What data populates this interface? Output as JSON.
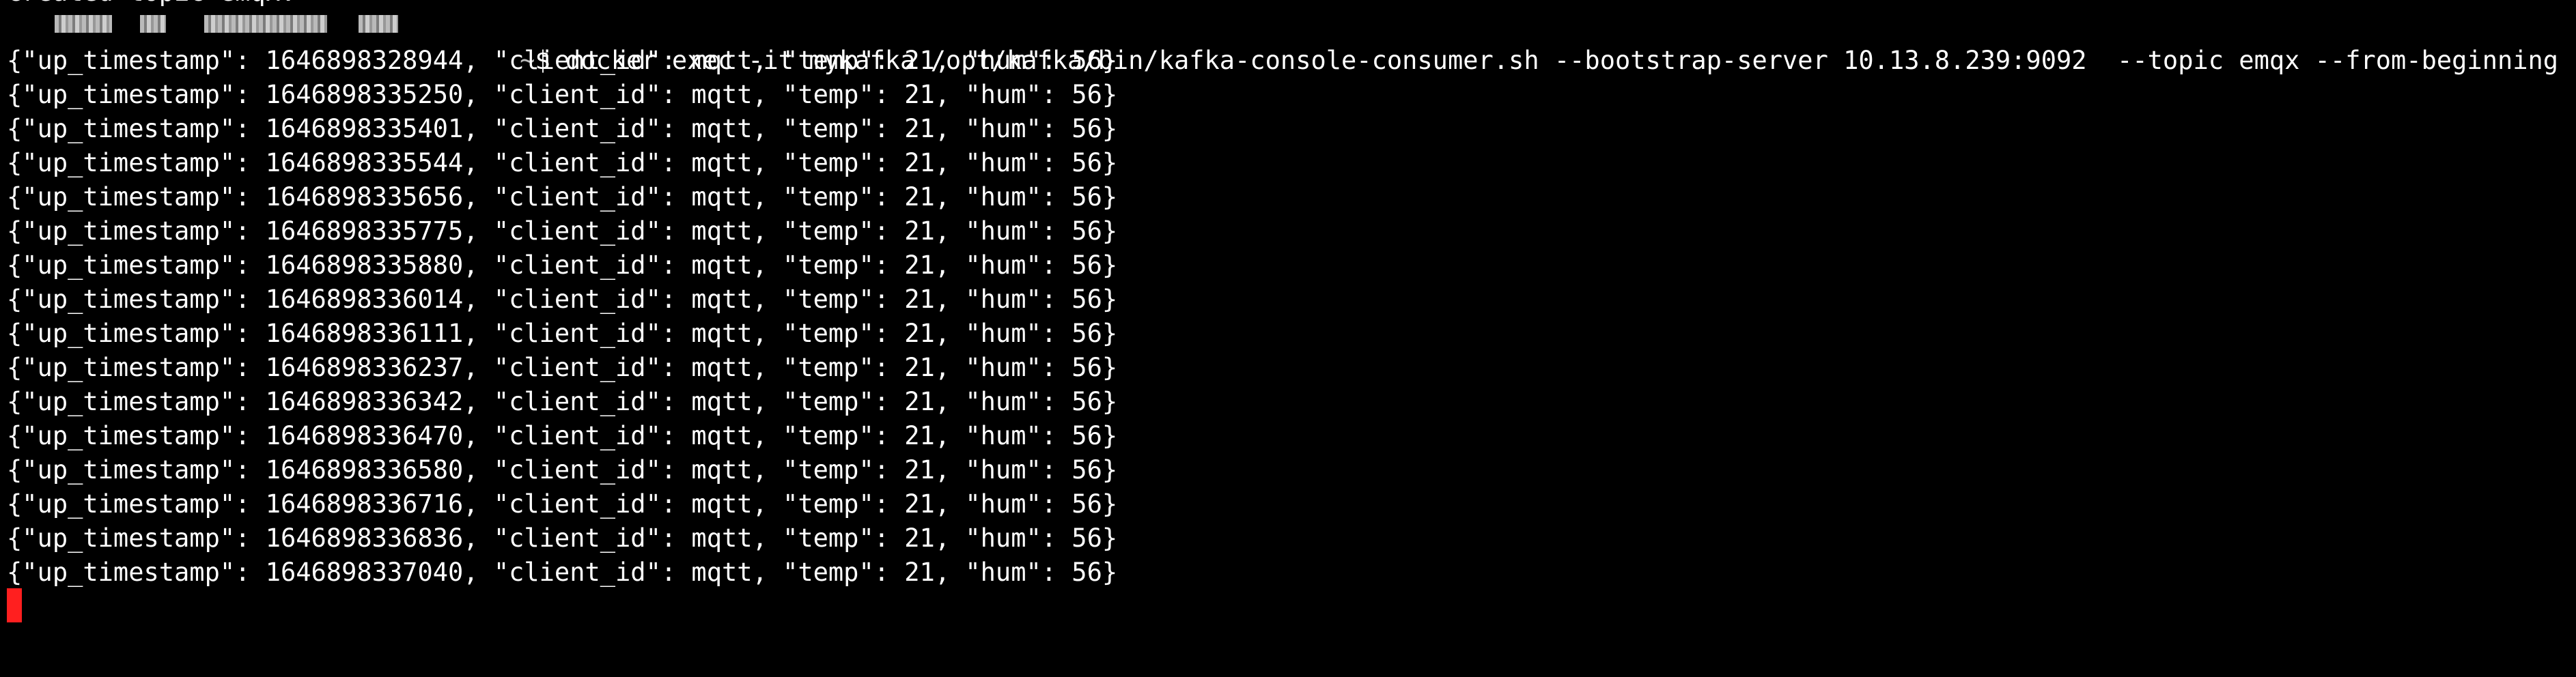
{
  "terminal": {
    "cut_text": "Created topic emqx.",
    "prompt_tilde": "~",
    "prompt_symbol": "$",
    "command": " docker exec -it mykafka /opt/kafka/bin/kafka-console-consumer.sh --bootstrap-server 10.13.8.239:9092  --topic emqx --from-beginning",
    "output_lines": [
      "{\"up_timestamp\": 1646898328944, \"client_id\": mqtt, \"temp\": 21, \"hum\": 56}",
      "{\"up_timestamp\": 1646898335250, \"client_id\": mqtt, \"temp\": 21, \"hum\": 56}",
      "{\"up_timestamp\": 1646898335401, \"client_id\": mqtt, \"temp\": 21, \"hum\": 56}",
      "{\"up_timestamp\": 1646898335544, \"client_id\": mqtt, \"temp\": 21, \"hum\": 56}",
      "{\"up_timestamp\": 1646898335656, \"client_id\": mqtt, \"temp\": 21, \"hum\": 56}",
      "{\"up_timestamp\": 1646898335775, \"client_id\": mqtt, \"temp\": 21, \"hum\": 56}",
      "{\"up_timestamp\": 1646898335880, \"client_id\": mqtt, \"temp\": 21, \"hum\": 56}",
      "{\"up_timestamp\": 1646898336014, \"client_id\": mqtt, \"temp\": 21, \"hum\": 56}",
      "{\"up_timestamp\": 1646898336111, \"client_id\": mqtt, \"temp\": 21, \"hum\": 56}",
      "{\"up_timestamp\": 1646898336237, \"client_id\": mqtt, \"temp\": 21, \"hum\": 56}",
      "{\"up_timestamp\": 1646898336342, \"client_id\": mqtt, \"temp\": 21, \"hum\": 56}",
      "{\"up_timestamp\": 1646898336470, \"client_id\": mqtt, \"temp\": 21, \"hum\": 56}",
      "{\"up_timestamp\": 1646898336580, \"client_id\": mqtt, \"temp\": 21, \"hum\": 56}",
      "{\"up_timestamp\": 1646898336716, \"client_id\": mqtt, \"temp\": 21, \"hum\": 56}",
      "{\"up_timestamp\": 1646898336836, \"client_id\": mqtt, \"temp\": 21, \"hum\": 56}",
      "{\"up_timestamp\": 1646898337040, \"client_id\": mqtt, \"temp\": 21, \"hum\": 56}"
    ],
    "colors": {
      "background": "#000000",
      "text": "#ffffff",
      "cursor": "#ff1f1f"
    }
  }
}
